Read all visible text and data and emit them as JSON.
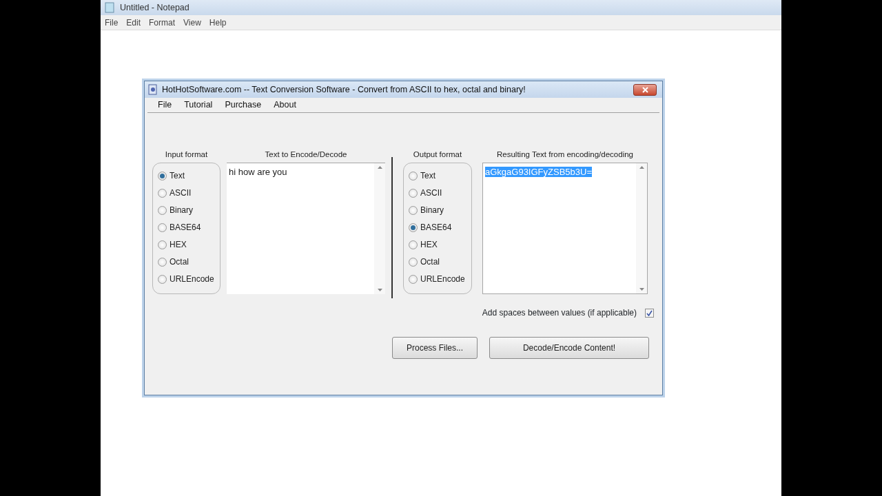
{
  "notepad": {
    "title": "Untitled - Notepad",
    "menu": [
      "File",
      "Edit",
      "Format",
      "View",
      "Help"
    ]
  },
  "dialog": {
    "title": "HotHotSoftware.com -- Text Conversion Software - Convert from ASCII to hex, octal and binary!",
    "menu": [
      "File",
      "Tutorial",
      "Purchase",
      "About"
    ],
    "input_format": {
      "label": "Input format",
      "options": [
        {
          "label": "Text",
          "selected": true
        },
        {
          "label": "ASCII",
          "selected": false
        },
        {
          "label": "Binary",
          "selected": false
        },
        {
          "label": "BASE64",
          "selected": false
        },
        {
          "label": "HEX",
          "selected": false
        },
        {
          "label": "Octal",
          "selected": false
        },
        {
          "label": "URLEncode",
          "selected": false
        }
      ]
    },
    "input_text": {
      "label": "Text to Encode/Decode",
      "value": "hi how are you"
    },
    "output_format": {
      "label": "Output format",
      "options": [
        {
          "label": "Text",
          "selected": false
        },
        {
          "label": "ASCII",
          "selected": false
        },
        {
          "label": "Binary",
          "selected": false
        },
        {
          "label": "BASE64",
          "selected": true
        },
        {
          "label": "HEX",
          "selected": false
        },
        {
          "label": "Octal",
          "selected": false
        },
        {
          "label": "URLEncode",
          "selected": false
        }
      ]
    },
    "output_text": {
      "label": "Resulting Text from encoding/decoding",
      "value": "aGkgaG93IGFyZSB5b3U=",
      "selected": true
    },
    "add_spaces": {
      "label": "Add spaces between values (if applicable)",
      "checked": true
    },
    "buttons": [
      "Process Files...",
      "Decode/Encode Content!"
    ]
  }
}
